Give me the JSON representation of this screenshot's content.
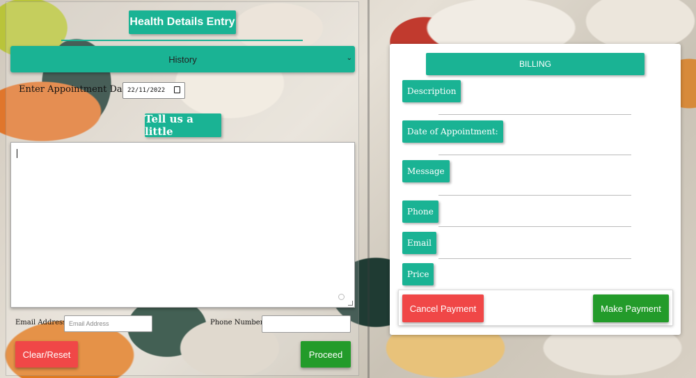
{
  "health_form": {
    "title": "Health Details Entry",
    "history_select": {
      "selected": "History"
    },
    "appointment": {
      "label": "Enter Appointment Date",
      "value": "22/11/2022"
    },
    "tell_us_label": "Tell us a little",
    "message_text": "",
    "email": {
      "label": "Email Address",
      "placeholder": "Email Address"
    },
    "phone": {
      "label": "Phone Number",
      "value": ""
    },
    "clear_label": "Clear/Reset",
    "proceed_label": "Proceed"
  },
  "billing": {
    "title": "BILLING",
    "fields": [
      {
        "label": "Description"
      },
      {
        "label": "Date of Appointment:"
      },
      {
        "label": "Message"
      },
      {
        "label": "Phone"
      },
      {
        "label": "Email"
      },
      {
        "label": "Price"
      }
    ],
    "cancel_label": "Cancel Payment",
    "pay_label": "Make Payment"
  },
  "colors": {
    "accent": "#1ab394",
    "danger": "#f04747",
    "success": "#239b2a"
  },
  "icons": [
    "chevron-down-icon",
    "calendar-icon",
    "resize-handle-icon"
  ]
}
